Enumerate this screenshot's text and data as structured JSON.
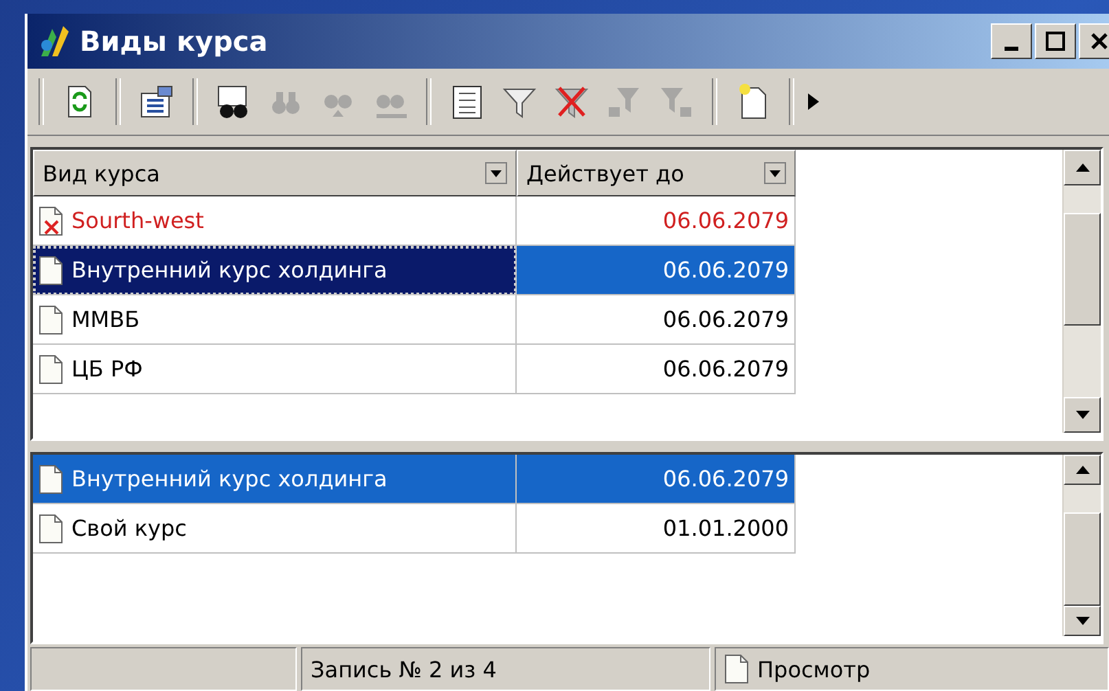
{
  "window": {
    "title": "Виды курса"
  },
  "toolbar": [
    {
      "kind": "separator"
    },
    {
      "kind": "button",
      "disabled": false
    },
    {
      "kind": "separator"
    },
    {
      "kind": "button",
      "disabled": false
    },
    {
      "kind": "separator"
    },
    {
      "kind": "button",
      "disabled": false
    },
    {
      "kind": "button",
      "disabled": true
    },
    {
      "kind": "button",
      "disabled": true
    },
    {
      "kind": "button",
      "disabled": true
    },
    {
      "kind": "separator"
    },
    {
      "kind": "button",
      "disabled": false
    },
    {
      "kind": "button",
      "disabled": false
    },
    {
      "kind": "button",
      "disabled": false
    },
    {
      "kind": "button",
      "disabled": true
    },
    {
      "kind": "button",
      "disabled": true
    },
    {
      "kind": "separator"
    },
    {
      "kind": "button",
      "disabled": false
    },
    {
      "kind": "separator"
    }
  ],
  "table": {
    "columns": [
      "Вид курса",
      "Действует до"
    ],
    "rows": [
      {
        "name": "Sourth-west",
        "date": "06.06.2079",
        "deleted": true,
        "selected": false,
        "focused": false
      },
      {
        "name": "Внутренний курс холдинга",
        "date": "06.06.2079",
        "deleted": false,
        "selected": true,
        "focused": true
      },
      {
        "name": "ММВБ",
        "date": "06.06.2079",
        "deleted": false,
        "selected": false,
        "focused": false
      },
      {
        "name": "ЦБ РФ",
        "date": "06.06.2079",
        "deleted": false,
        "selected": false,
        "focused": false
      }
    ]
  },
  "detail_table": {
    "rows": [
      {
        "name": "Внутренний курс холдинга",
        "date": "06.06.2079",
        "deleted": false,
        "selected": true,
        "focused": false
      },
      {
        "name": "Свой курс",
        "date": "01.01.2000",
        "deleted": false,
        "selected": false,
        "focused": false
      }
    ]
  },
  "status_bar": {
    "record": "Запись № 2 из 4",
    "mode": "Просмотр"
  }
}
